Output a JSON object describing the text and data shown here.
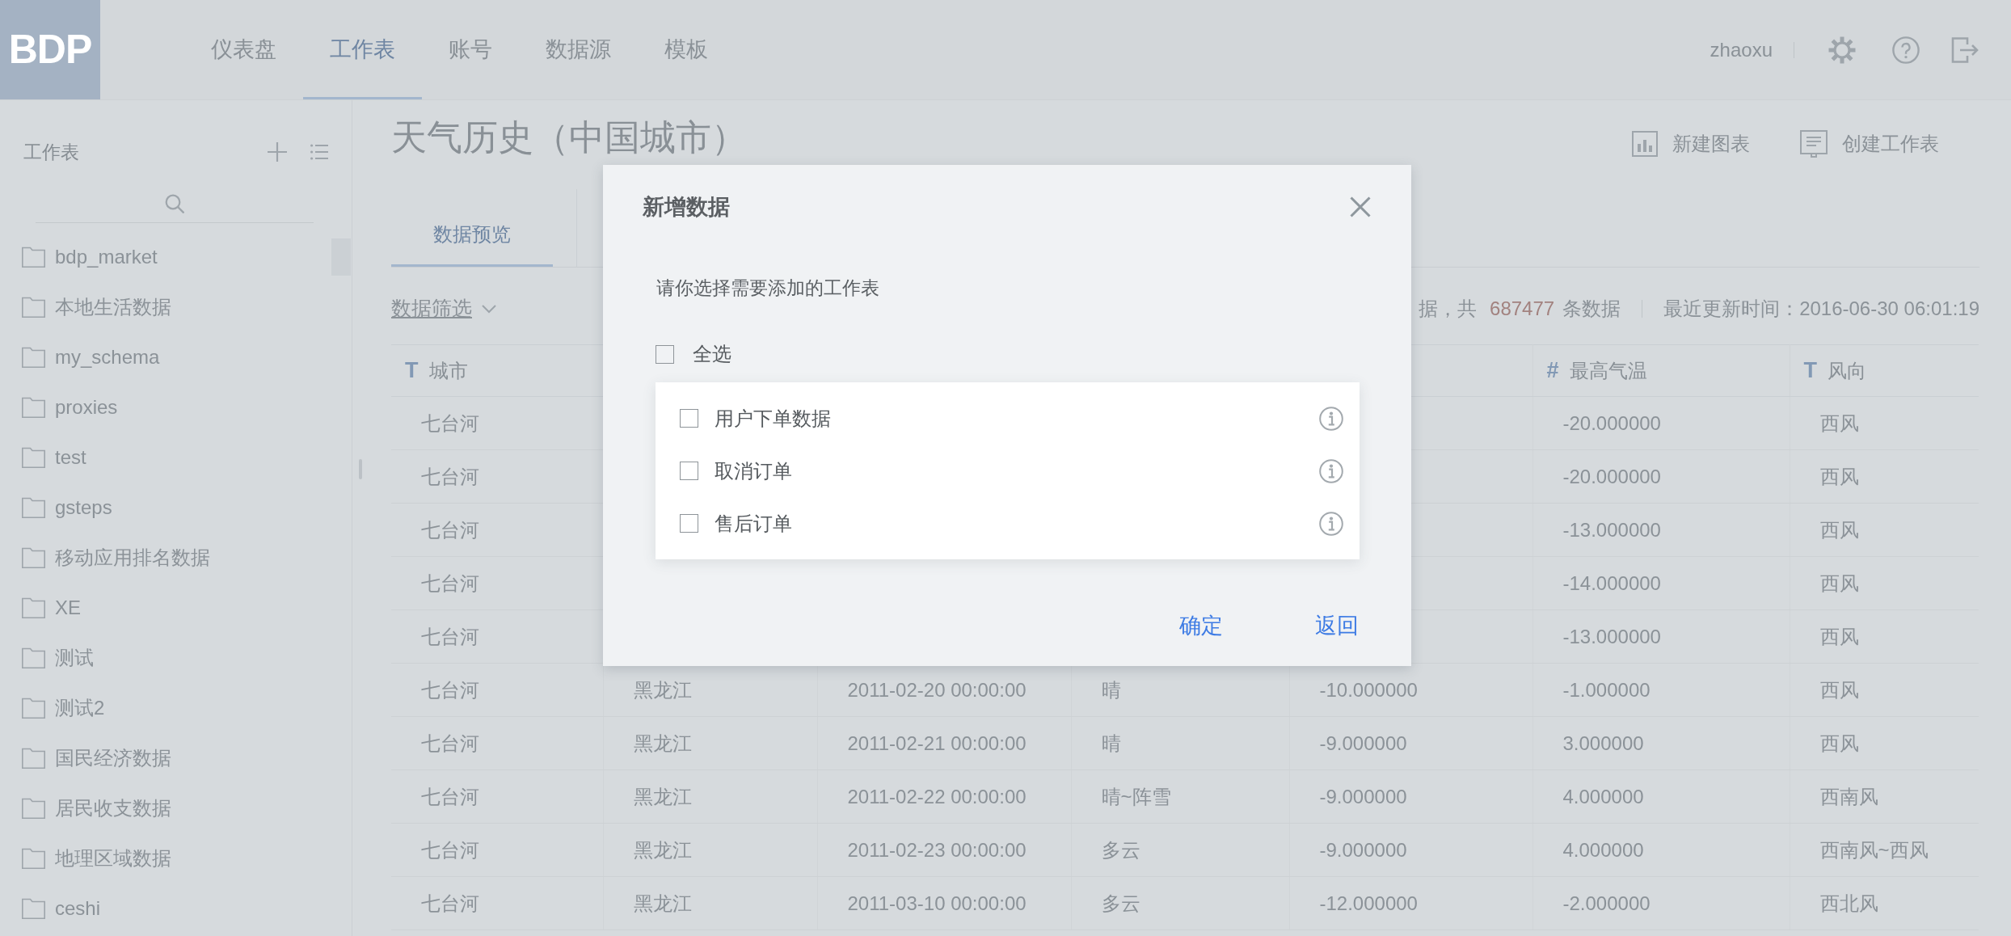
{
  "nav": {
    "logo": "BDP",
    "items": [
      {
        "label": "仪表盘",
        "selected": false
      },
      {
        "label": "工作表",
        "selected": true
      },
      {
        "label": "账号",
        "selected": false
      },
      {
        "label": "数据源",
        "selected": false
      },
      {
        "label": "模板",
        "selected": false
      }
    ],
    "user": "zhaoxu"
  },
  "sidebar": {
    "title": "工作表",
    "items": [
      "bdp_market",
      "本地生活数据",
      "my_schema",
      "proxies",
      "test",
      "gsteps",
      "移动应用排名数据",
      "XE",
      "测试",
      "测试2",
      "国民经济数据",
      "居民收支数据",
      "地理区域数据",
      "ceshi"
    ]
  },
  "page": {
    "title": "天气历史（中国城市）",
    "actions": [
      {
        "kind": "chart",
        "label": "新建图表"
      },
      {
        "kind": "sheet",
        "label": "创建工作表"
      }
    ],
    "tabs": [
      {
        "label": "数据预览",
        "selected": true
      }
    ],
    "filter": {
      "label": "数据筛选"
    },
    "summary": {
      "count_prefix": "据，共",
      "count": "687477",
      "count_suffix": "条数据",
      "updated": "最近更新时间：2016-06-30 06:01:19"
    }
  },
  "table": {
    "columns": [
      {
        "icon": "T",
        "label": "城市"
      },
      null,
      null,
      null,
      null,
      {
        "icon": "#",
        "label": "最高气温"
      },
      {
        "icon": "T",
        "label": "风向"
      }
    ],
    "rows": [
      [
        "七台河",
        null,
        null,
        null,
        null,
        "-20.000000",
        "西风"
      ],
      [
        "七台河",
        null,
        null,
        null,
        null,
        "-20.000000",
        "西风"
      ],
      [
        "七台河",
        null,
        null,
        null,
        null,
        "-13.000000",
        "西风"
      ],
      [
        "七台河",
        null,
        null,
        null,
        null,
        "-14.000000",
        "西风"
      ],
      [
        "七台河",
        null,
        null,
        null,
        null,
        "-13.000000",
        "西风"
      ],
      [
        "七台河",
        "黑龙江",
        "2011-02-20 00:00:00",
        "晴",
        "-10.000000",
        "-1.000000",
        "西风"
      ],
      [
        "七台河",
        "黑龙江",
        "2011-02-21 00:00:00",
        "晴",
        "-9.000000",
        "3.000000",
        "西风"
      ],
      [
        "七台河",
        "黑龙江",
        "2011-02-22 00:00:00",
        "晴~阵雪",
        "-9.000000",
        "4.000000",
        "西南风"
      ],
      [
        "七台河",
        "黑龙江",
        "2011-02-23 00:00:00",
        "多云",
        "-9.000000",
        "4.000000",
        "西南风~西风"
      ],
      [
        "七台河",
        "黑龙江",
        "2011-03-10 00:00:00",
        "多云",
        "-12.000000",
        "-2.000000",
        "西北风"
      ]
    ]
  },
  "dialog": {
    "title": "新增数据",
    "prompt": "请你选择需要添加的工作表",
    "select_all": {
      "label": "全选",
      "checked": false
    },
    "items": [
      {
        "label": "用户下单数据",
        "checked": false
      },
      {
        "label": "取消订单",
        "checked": false
      },
      {
        "label": "售后订单",
        "checked": false
      }
    ],
    "buttons": [
      "确定",
      "返回"
    ]
  }
}
